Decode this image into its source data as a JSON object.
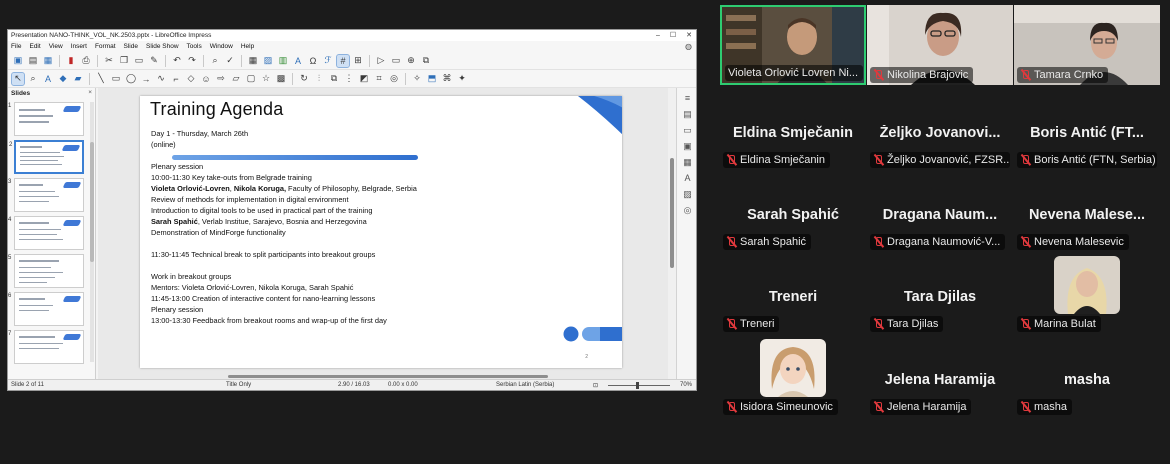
{
  "lo": {
    "title": "Presentation NANO-THINK_VOL_NK.2503.pptx - LibreOffice Impress",
    "window_controls": [
      "–",
      "☐",
      "✕"
    ],
    "menus": [
      "File",
      "Edit",
      "View",
      "Insert",
      "Format",
      "Slide",
      "Slide Show",
      "Tools",
      "Window",
      "Help"
    ],
    "slides_pane_title": "Slides",
    "slide_numbers": [
      "1",
      "2",
      "3",
      "4",
      "5",
      "6",
      "7"
    ],
    "status": {
      "slide": "Slide 2 of 11",
      "layout": "Title Only",
      "position": "2.90 / 16.03",
      "size": "0.00 x 0.00",
      "language": "Serbian Latin (Serbia)",
      "zoom": "70%"
    }
  },
  "slide": {
    "title": "Training Agenda",
    "day": "Day 1 - Thursday, March 26th",
    "mode": "(online)",
    "plenary1": "Plenary session",
    "l1": "10:00-11:30 Key take-outs from Belgrade training",
    "l2_bold": "Violeta Orlović-Lovren",
    "l2_sep": ", ",
    "l2_bold2": "Nikola Koruga,",
    "l2_rest": " Faculty of Philosophy, Belgrade, Serbia",
    "l3": "Review of methods for implementation in digital environment",
    "l4": "Introduction to digital tools to be used in practical part of the training",
    "l5_bold": "Sarah Spahić",
    "l5_rest": ", Verlab Institue, Sarajevo, Bosnia and Herzegovina",
    "l6": "Demonstration of MindForge functionality",
    "l7": "11:30-11:45 Technical break to split participants into breakout groups",
    "l8": "Work in breakout groups",
    "l9": "Mentors: Violeta Orlović-Lovren, Nikola Koruga, Sarah Spahić",
    "l10": "11:45-13:00 Creation of interactive content for nano-learning lessons",
    "plenary2": "Plenary session",
    "l11": "13:00-13:30 Feedback from breakout rooms and wrap-up of the first day",
    "page_num": "2",
    "accent": "#2f6fcf"
  },
  "participants": [
    {
      "big": "",
      "label": "Violeta Orlović Lovren Ni...",
      "video": true
    },
    {
      "big": "",
      "label": "Nikolina Brajovic",
      "video": true
    },
    {
      "big": "",
      "label": "Tamara Crnko",
      "video": true
    },
    {
      "big": "Eldina Smječanin",
      "label": "Eldina Smječanin"
    },
    {
      "big": "Željko Jovanovi...",
      "label": "Željko Jovanović, FZSR..."
    },
    {
      "big": "Boris Antić (FT...",
      "label": "Boris Antić (FTN, Serbia)"
    },
    {
      "big": "Sarah Spahić",
      "label": "Sarah Spahić"
    },
    {
      "big": "Dragana Naum...",
      "label": "Dragana Naumović-V..."
    },
    {
      "big": "Nevena Malese...",
      "label": "Nevena Malesevic"
    },
    {
      "big": "Treneri",
      "label": "Treneri"
    },
    {
      "big": "Tara Djilas",
      "label": "Tara Djilas"
    },
    {
      "big": "",
      "label": "Marina Bulat",
      "avatar": true
    },
    {
      "big": "",
      "label": "Isidora Simeunovic",
      "avatar": true
    },
    {
      "big": "Jelena Haramija",
      "label": "Jelena Haramija"
    },
    {
      "big": "masha",
      "label": "masha"
    }
  ],
  "colors": {
    "active_speaker": "#2ecc71",
    "muted": "#e0393d"
  }
}
